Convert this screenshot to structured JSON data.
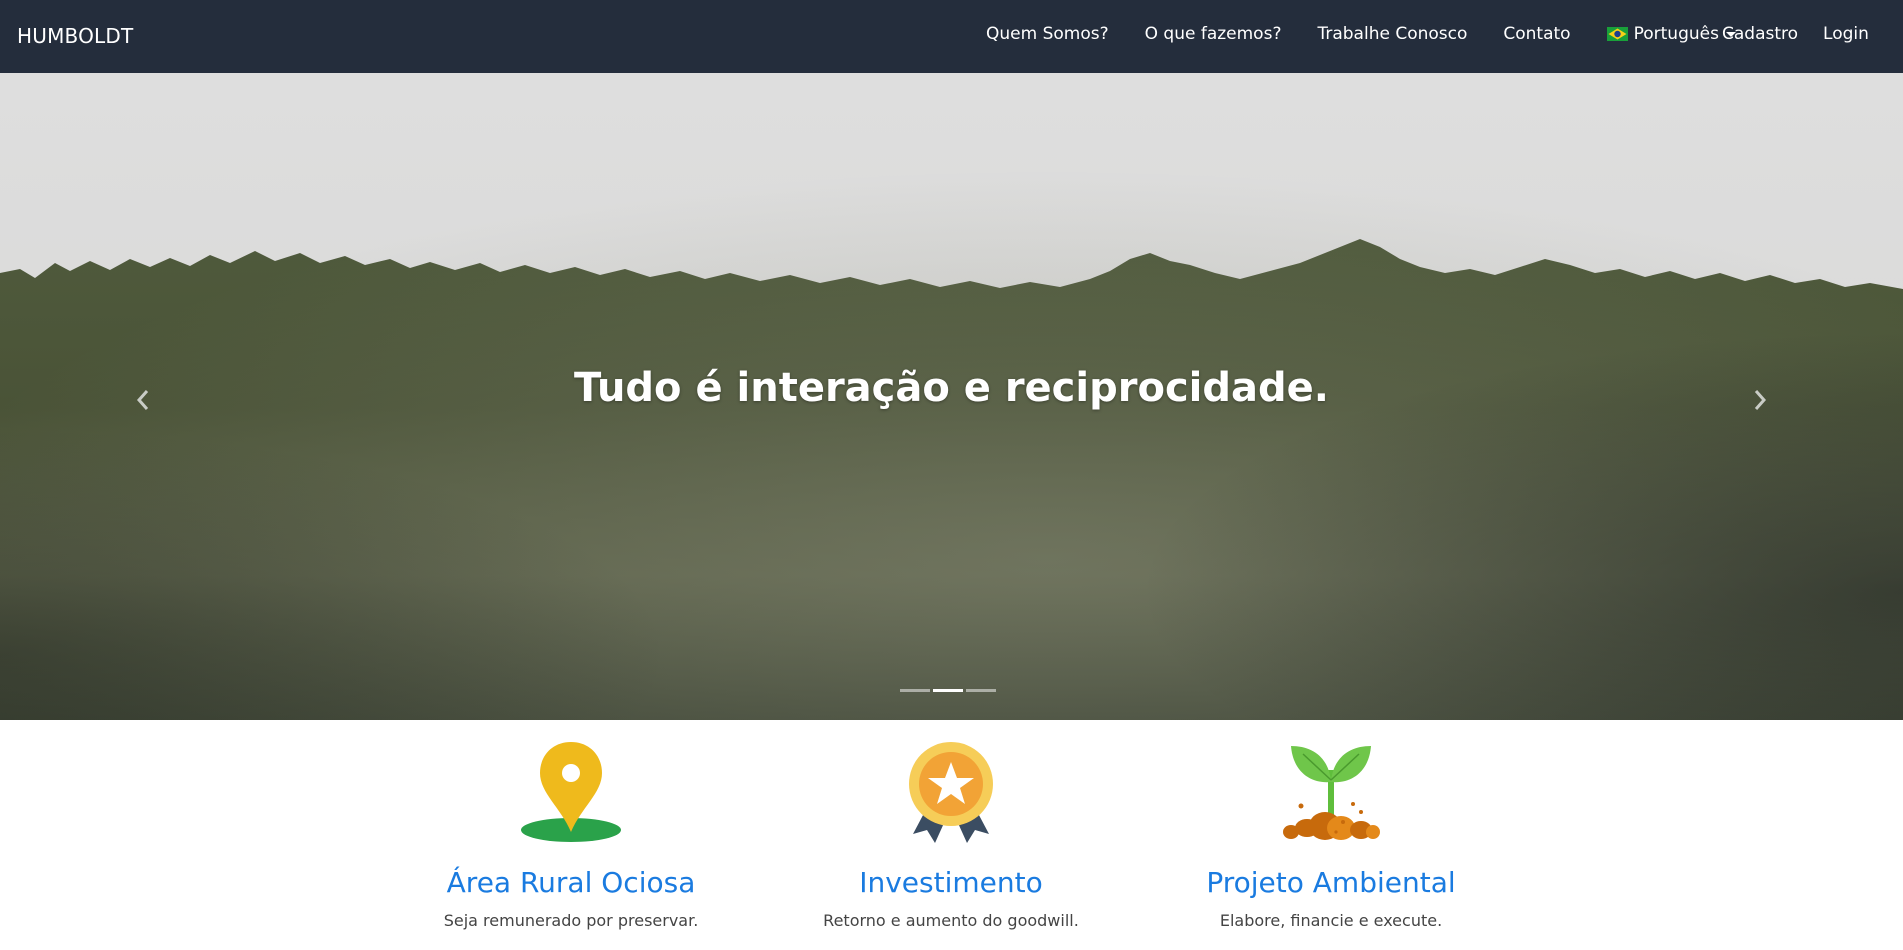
{
  "navbar": {
    "brand": "HUMBOLDT",
    "links": {
      "about": "Quem Somos?",
      "services": "O que fazemos?",
      "careers": "Trabalhe Conosco",
      "contact": "Contato"
    },
    "language": {
      "selected": "Português",
      "flag_icon": "brazil-flag-icon"
    },
    "signup": "Cadastro",
    "login": "Login",
    "colors": {
      "background": "#242d3c",
      "text": "#ffffff"
    }
  },
  "carousel": {
    "caption": "Tudo é interação e reciprocidade.",
    "prev_icon": "chevron-left-icon",
    "next_icon": "chevron-right-icon",
    "slide_count": 3,
    "active_index": 1
  },
  "features": [
    {
      "icon": "map-pin-icon",
      "title": "Área Rural Ociosa",
      "description": "Seja remunerado por preservar."
    },
    {
      "icon": "award-medal-icon",
      "title": "Investimento",
      "description": "Retorno e aumento do goodwill."
    },
    {
      "icon": "seedling-icon",
      "title": "Projeto Ambiental",
      "description": "Elabore, financie e execute."
    }
  ],
  "colors": {
    "feature_title": "#1a7be0",
    "feature_desc": "#444444"
  }
}
